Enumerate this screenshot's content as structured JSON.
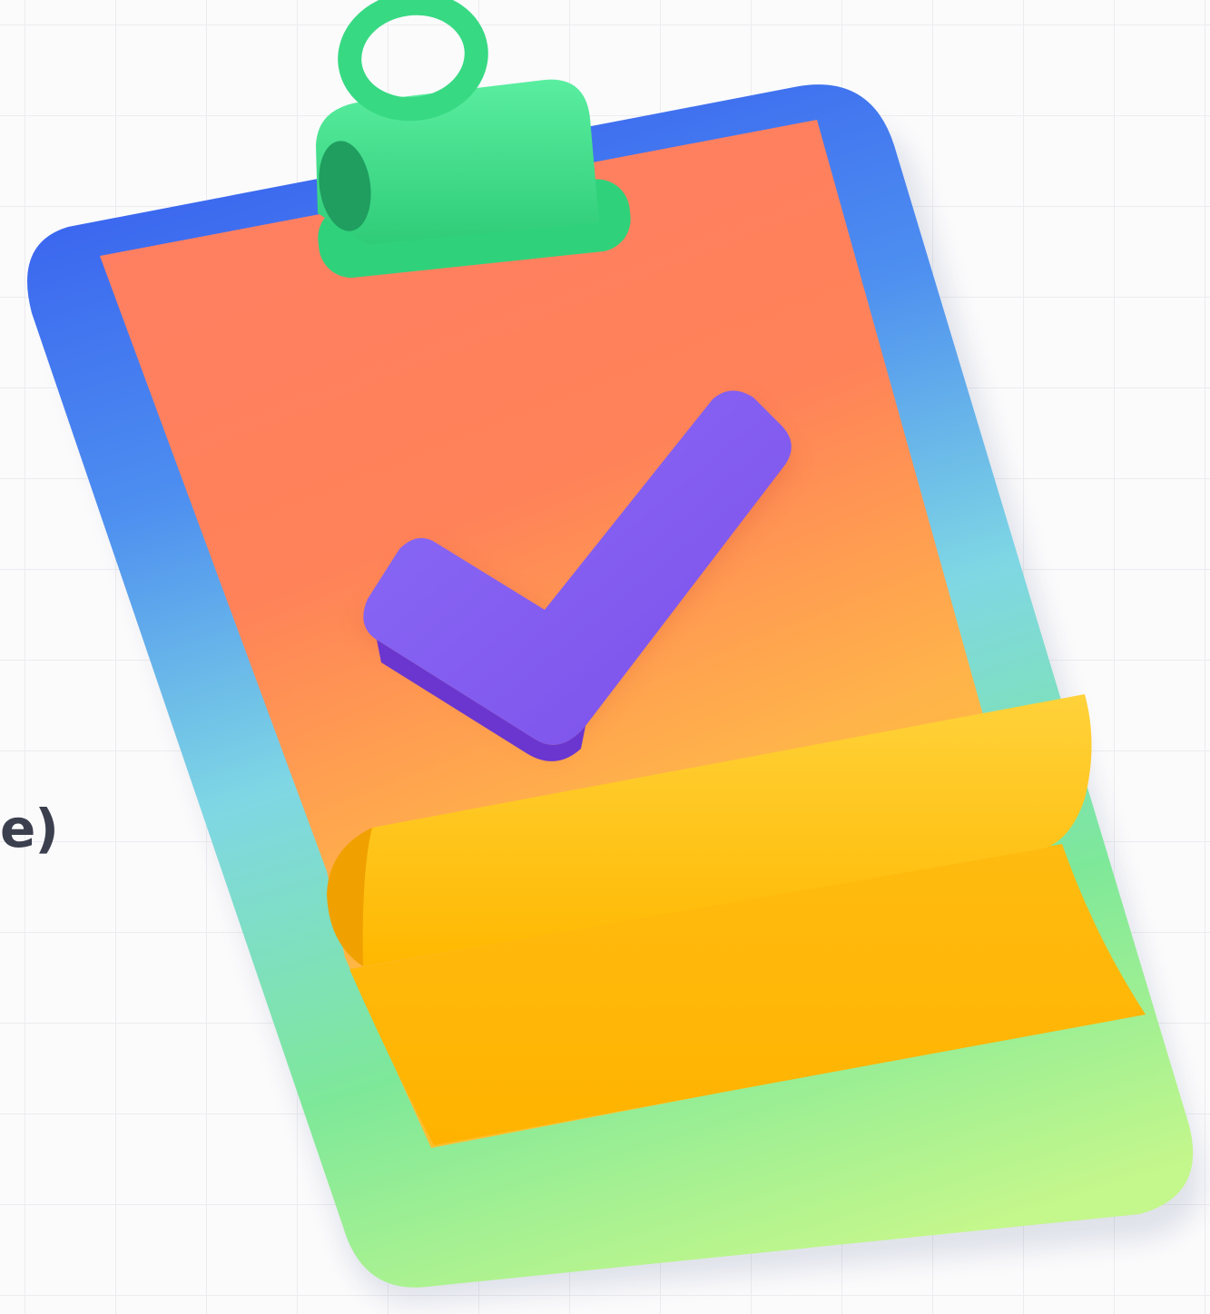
{
  "partial_text": "e)",
  "illustration": {
    "subject": "clipboard-with-checkmark",
    "colors": {
      "board_top": "#3f6cf0",
      "board_mid": "#7fd6e6",
      "board_bottom": "#c2f78a",
      "clip": "#3fdc86",
      "paper_top": "#ff7a5e",
      "paper_bottom": "#ffc21a",
      "check": "#8a5cf5"
    }
  }
}
